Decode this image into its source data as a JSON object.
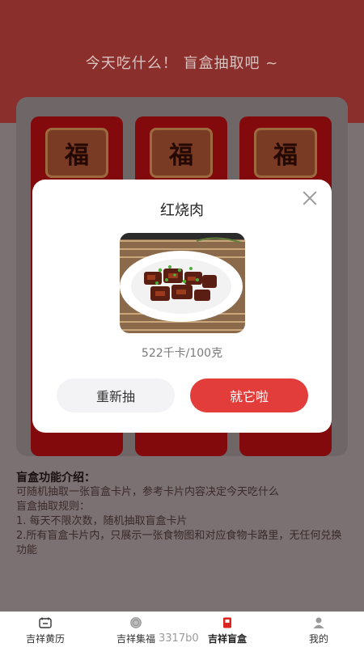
{
  "header": {
    "title": "今天吃什么！ 盲盒抽取吧 ~"
  },
  "cards": [
    {
      "symbol": "福"
    },
    {
      "symbol": "福"
    },
    {
      "symbol": "福"
    }
  ],
  "intro": {
    "title": "盲盒功能介绍：",
    "lines": [
      "可随机抽取一张盲盒卡片，参考卡片内容决定今天吃什么",
      "盲盒抽取规则：",
      "1. 每天不限次数，随机抽取盲盒卡片",
      "2.所有盲盒卡片内，只展示一张食物图和对应食物卡路里，无任何兑换功能"
    ]
  },
  "modal": {
    "title": "红烧肉",
    "calorie": "522千卡/100克",
    "redraw_label": "重新抽",
    "confirm_label": "就它啦"
  },
  "tabbar": {
    "tabs": [
      {
        "label": "吉祥黄历",
        "icon": "calendar-icon"
      },
      {
        "label": "吉祥集福",
        "icon": "fu-coin-icon"
      },
      {
        "label": "吉祥盲盒",
        "icon": "blind-box-icon",
        "active": true
      },
      {
        "label": "我的",
        "icon": "user-icon"
      }
    ]
  },
  "watermark": "3317b0",
  "colors": {
    "accent": "#e23d3a",
    "header": "#c9473f",
    "card": "#c8161d"
  }
}
